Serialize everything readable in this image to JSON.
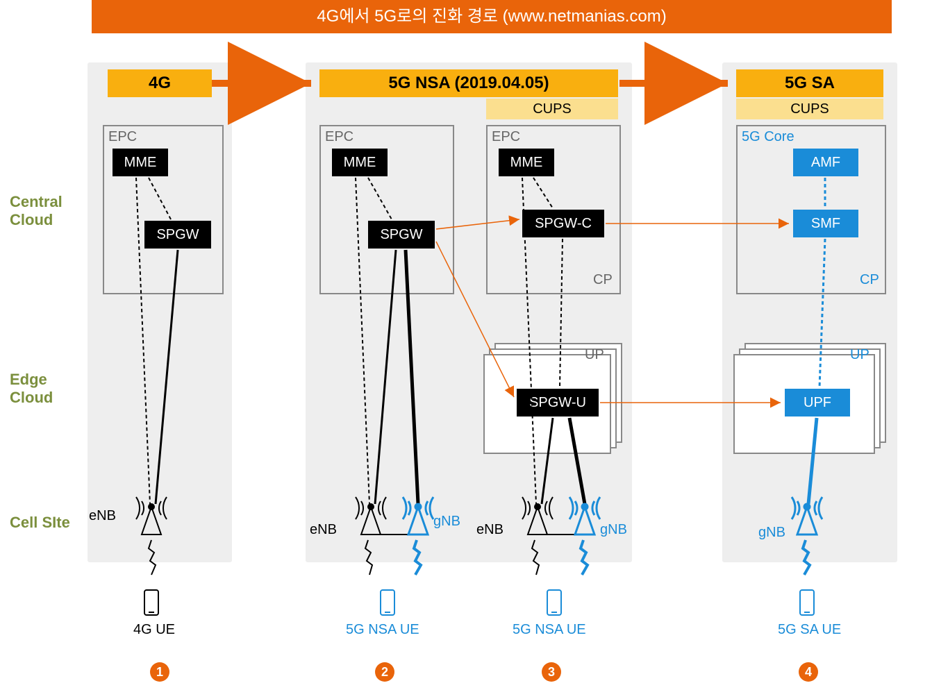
{
  "title_banner": "4G에서 5G로의 진화 경로 (www.netmanias.com)",
  "row_labels": {
    "central": "Central\nCloud",
    "edge": "Edge\nCloud",
    "cell": "Cell SIte"
  },
  "stage": {
    "g4": "4G",
    "nsa": "5G NSA (2019.04.05)",
    "sa": "5G SA",
    "cups": "CUPS"
  },
  "labels": {
    "epc": "EPC",
    "core5g": "5G Core",
    "cp": "CP",
    "up": "UP",
    "mme": "MME",
    "spgw": "SPGW",
    "spgwc": "SPGW-C",
    "spgwu": "SPGW-U",
    "amf": "AMF",
    "smf": "SMF",
    "upf": "UPF",
    "enb": "eNB",
    "gnb": "gNB",
    "ue4g": "4G UE",
    "ue5gnsa": "5G NSA UE",
    "ue5gsa": "5G SA UE"
  },
  "badges": {
    "b1": "1",
    "b2": "2",
    "b3": "3",
    "b4": "4"
  }
}
